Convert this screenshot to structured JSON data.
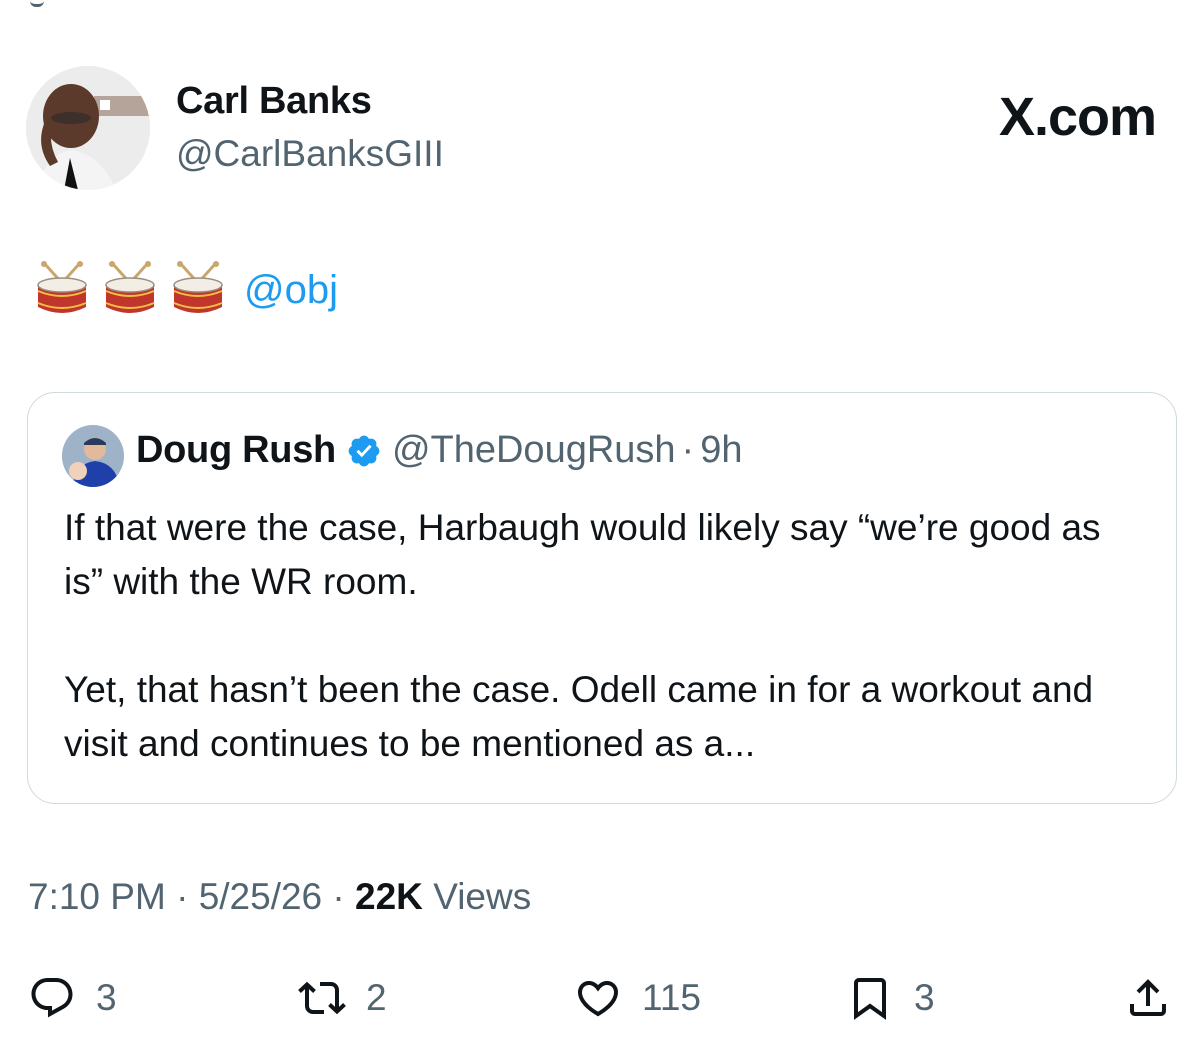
{
  "author": {
    "name": "Carl Banks",
    "handle": "@CarlBanksGIII",
    "avatar_icon": "avatar-photo"
  },
  "brand": {
    "label": "X.com"
  },
  "tweet": {
    "emojis": [
      "drum-icon",
      "drum-icon",
      "drum-icon"
    ],
    "mention": "@obj"
  },
  "quoted": {
    "name": "Doug Rush",
    "verified_icon": "verified-badge-icon",
    "handle": "@TheDougRush",
    "separator": "·",
    "time": "9h",
    "text": "If that were the case, Harbaugh would likely say “we’re good as is” with the WR room.\n\nYet, that hasn’t been the case. Odell came in for a workout and visit and continues to be mentioned as a..."
  },
  "meta": {
    "time": "7:10 PM",
    "sep1": "·",
    "date": "5/25/26",
    "sep2": "·",
    "views_count": "22K",
    "views_label": "Views"
  },
  "actions": {
    "replies": "3",
    "reposts": "2",
    "likes": "115",
    "bookmarks": "3"
  },
  "colors": {
    "link": "#1d9bf0",
    "secondary_text": "#536471",
    "border": "#cfd9de",
    "primary_text": "#0f1419"
  }
}
